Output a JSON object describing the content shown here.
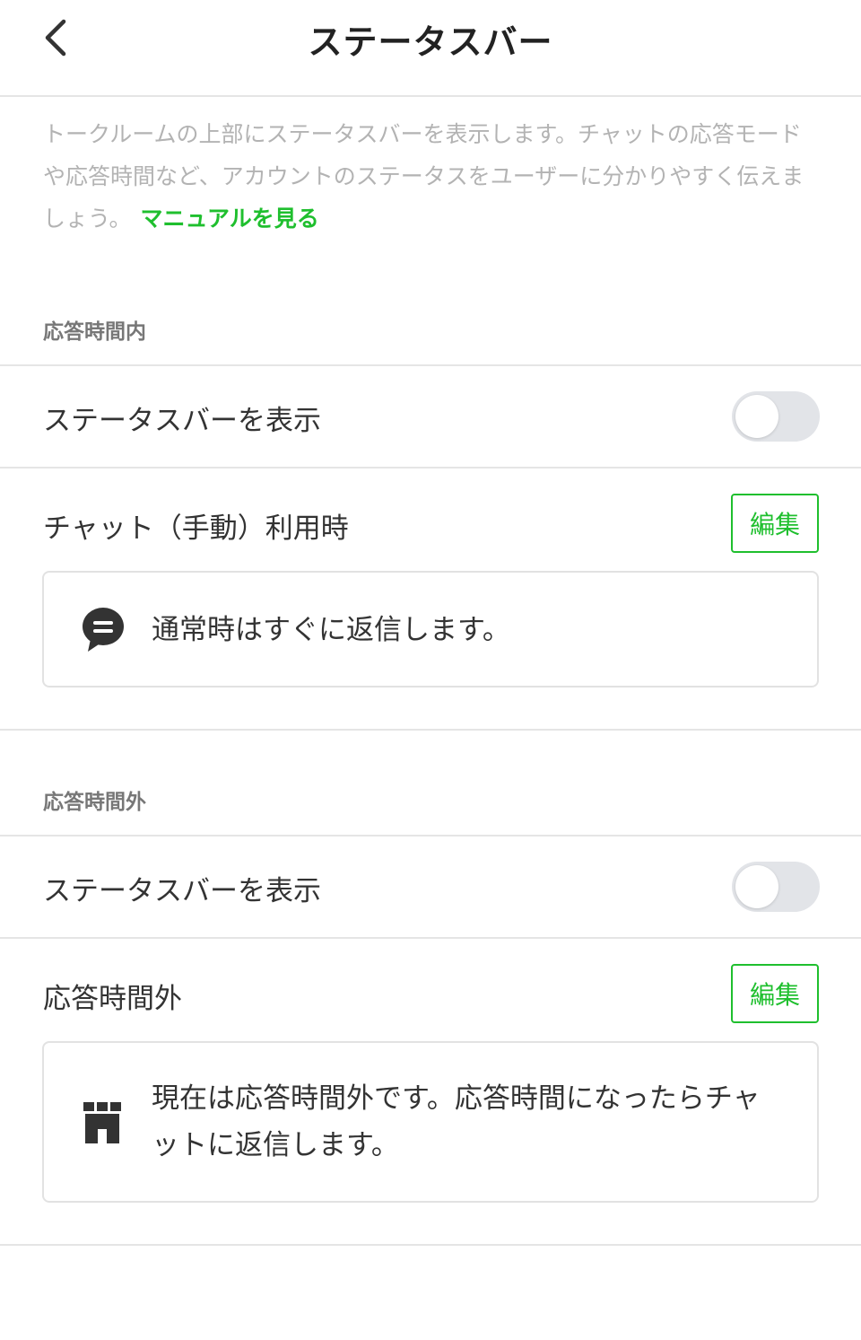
{
  "header": {
    "title": "ステータスバー",
    "back_icon": "chevron-left-icon"
  },
  "intro": {
    "description": "トークルームの上部にステータスバーを表示します。チャットの応答モードや応答時間など、アカウントのステータスをユーザーに分かりやすく伝えましょう。",
    "manual_link": "マニュアルを見る"
  },
  "colors": {
    "accent": "#1fbf2e",
    "toggle_off": "#e2e4e8",
    "muted_text": "#b3b3b3"
  },
  "sections": [
    {
      "label": "応答時間内",
      "toggle_label": "ステータスバーを表示",
      "toggle_on": false,
      "message_label": "チャット（手動）利用時",
      "edit_label": "編集",
      "message_icon": "chat-bubble-icon",
      "message_text": "通常時はすぐに返信します。"
    },
    {
      "label": "応答時間外",
      "toggle_label": "ステータスバーを表示",
      "toggle_on": false,
      "message_label": "応答時間外",
      "edit_label": "編集",
      "message_icon": "shop-closed-icon",
      "message_text": "現在は応答時間外です。応答時間になったらチャットに返信します。"
    }
  ]
}
